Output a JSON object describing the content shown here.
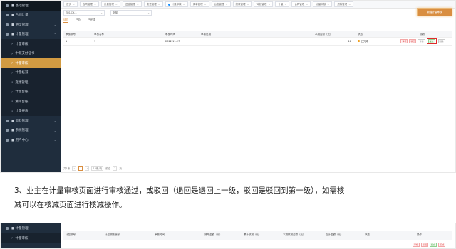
{
  "shot1": {
    "sidebar": [
      {
        "label": "■ 基础管理",
        "kind": "group"
      },
      {
        "label": "■ 合同计量",
        "kind": "group"
      },
      {
        "label": "■ 进度管理",
        "kind": "group"
      },
      {
        "label": "■ 计量管理",
        "kind": "group"
      },
      {
        "label": "计量审核",
        "kind": "sub"
      },
      {
        "label": "中期支付证书",
        "kind": "sub"
      },
      {
        "label": "计量审核",
        "kind": "sub-active"
      },
      {
        "label": "计量核减",
        "kind": "sub"
      },
      {
        "label": "变更管理",
        "kind": "sub"
      },
      {
        "label": "计量台账",
        "kind": "sub"
      },
      {
        "label": "清单台账",
        "kind": "sub"
      },
      {
        "label": "计量报表",
        "kind": "sub"
      },
      {
        "label": "■ 资料管理",
        "kind": "group"
      },
      {
        "label": "■ 系统管理",
        "kind": "group"
      },
      {
        "label": "■ 用户中心",
        "kind": "group"
      }
    ],
    "tabs": [
      "首页",
      "合同管理",
      "计量管理",
      "进度管理",
      "变更管理",
      "计量审核",
      "清单管理",
      "台账管理",
      "报表管理",
      "审批管理",
      "计量",
      "合同管理",
      "计量审核",
      "资料管理"
    ],
    "filter": {
      "contract": "TLS-CX-1",
      "period": "全部"
    },
    "add_button": "新增计量审核",
    "subtabs": [
      "待办",
      "已办",
      "已完成"
    ],
    "table": {
      "headers": [
        "审核期号",
        "审核名称",
        "审核时间",
        "审核日期",
        "本期金额（元）",
        "状态",
        "操作"
      ],
      "rows": [
        {
          "no": "1",
          "name": "1",
          "time": "2022-11-27",
          "date": "",
          "amount": "18",
          "status": "已完成",
          "ops": [
            "审核",
            "驳回",
            "详情",
            "提交",
            "删除"
          ]
        }
      ]
    },
    "pager": [
      "共1条",
      "‹",
      "1",
      "›",
      "10条/页",
      "前往",
      "1",
      "页"
    ]
  },
  "caption": {
    "line1": "3、业主在计量审核页面进行审核通过，或驳回（退回是退回上一级，驳回是驳回到第一级），如需核",
    "line2": "减可以在核减页面进行核减操作。"
  },
  "shot2": {
    "sidebar": [
      {
        "label": "■ 计量管理",
        "kind": "group"
      },
      {
        "label": "计量审核",
        "kind": "sub"
      }
    ],
    "headers": [
      "计量期号",
      "计量期数编号",
      "审核时间",
      "清单金额（元）",
      "累计核减（元）",
      "本期核减金额（元）",
      "合计金额（元）",
      "状态",
      "操作"
    ],
    "ops": [
      "审核",
      "驳回",
      "提交",
      "核减"
    ]
  }
}
